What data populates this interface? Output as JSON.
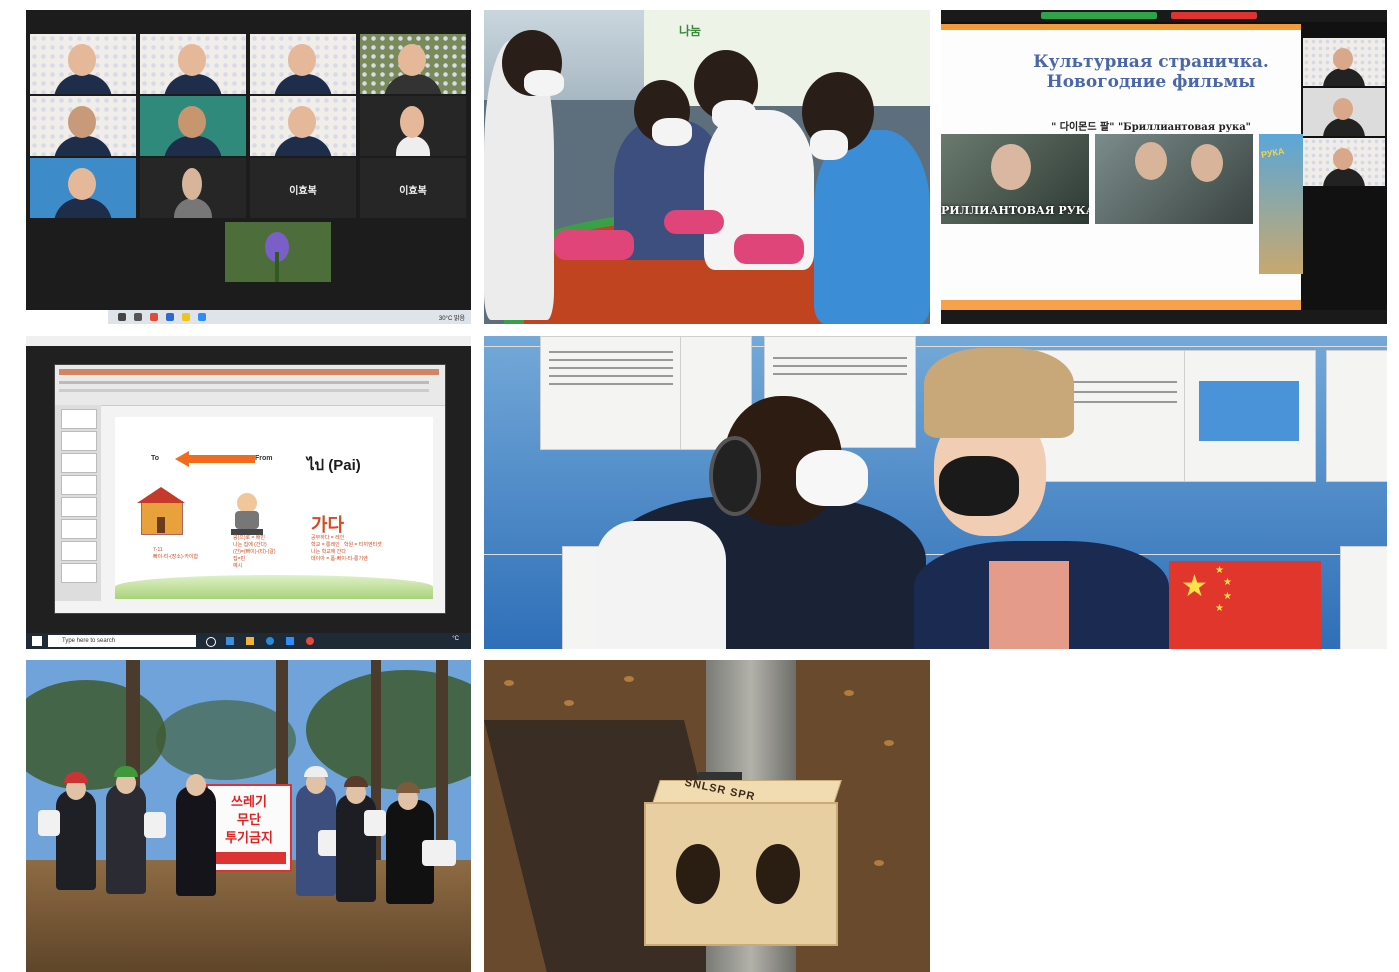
{
  "zoom_gallery": {
    "names": [
      "이효복",
      "이효복"
    ],
    "tray_text": "30°C 맑음"
  },
  "kimchi": {
    "banner_text": "나눔"
  },
  "russian_slide": {
    "title_line1": "Культурная страничка.",
    "title_line2": "Новогодние фильмы",
    "subtitle": "\" 다이몬드 팔\" \"Бриллиантовая рука\"",
    "film_caption": "РИЛЛИАНТОВАЯ РУКА",
    "poster_text": "РУКА"
  },
  "thai_lesson": {
    "to_label": "To",
    "from_label": "From",
    "thai_word": "ไป (Pai)",
    "korean_word": "가다",
    "note_left": "7-11\n빠이-티-(장소)-카이합",
    "note_mid": "콩(으)로 = 배민\n나는 집에 (간다)\n(간)=(빠이)-(티)-(갈)\n집=빈\n예시",
    "note_right": "공부하다 = 레인\n학교 = 롱레인   학원 = 티끼엔티셋\n나는 학교에 간다\n데이아 = 폼-빠이-티-롱기엔",
    "search_placeholder": "Type here to search",
    "tray_text": "°C"
  },
  "litter_campaign": {
    "banner_lines": [
      "쓰레기",
      "무단",
      "투기금지"
    ]
  },
  "acorn_box": {
    "label": "SNLSR SPR"
  }
}
